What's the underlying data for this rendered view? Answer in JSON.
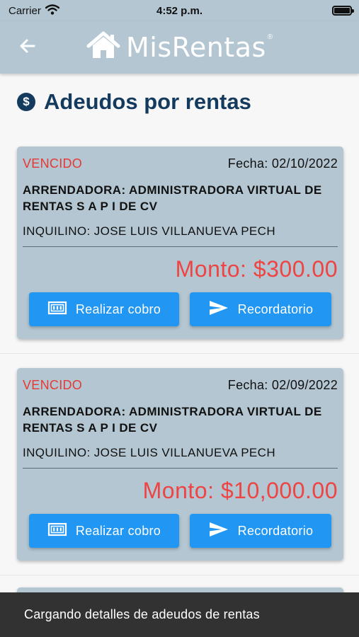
{
  "status_bar": {
    "carrier": "Carrier",
    "time": "4:52 p.m."
  },
  "app_bar": {
    "brand": "MisRentas",
    "registered_mark": "®"
  },
  "page": {
    "title": "Adeudos por rentas"
  },
  "cards": [
    {
      "status": "VENCIDO",
      "fecha": "Fecha: 02/10/2022",
      "arrendadora": "ARRENDADORA: ADMINISTRADORA VIRTUAL DE RENTAS S A P I DE CV",
      "inquilino": "INQUILINO: JOSE LUIS VILLANUEVA PECH",
      "monto": "Monto: $300.00",
      "cobro_label": "Realizar cobro",
      "recordatorio_label": "Recordatorio"
    },
    {
      "status": "VENCIDO",
      "fecha": "Fecha: 02/09/2022",
      "arrendadora": "ARRENDADORA: ADMINISTRADORA VIRTUAL DE RENTAS S A P I DE CV",
      "inquilino": "INQUILINO: JOSE LUIS VILLANUEVA PECH",
      "monto": "Monto: $10,000.00",
      "cobro_label": "Realizar cobro",
      "recordatorio_label": "Recordatorio"
    }
  ],
  "snackbar": {
    "message": "Cargando detalles de adeudos de rentas"
  },
  "colors": {
    "app_bar": "#b3c6d1",
    "card": "#b3c6d1",
    "title": "#143a5e",
    "status_red": "#e53935",
    "amount_red": "#ef4444",
    "button_blue": "#2196f3",
    "snackbar": "#323232"
  },
  "icons": {
    "back": "arrow-left-icon",
    "logo": "house-icon",
    "title": "dollar-circle-icon",
    "cobro": "cash-icon",
    "recordatorio": "send-icon",
    "wifi": "wifi-icon",
    "battery": "battery-icon"
  }
}
